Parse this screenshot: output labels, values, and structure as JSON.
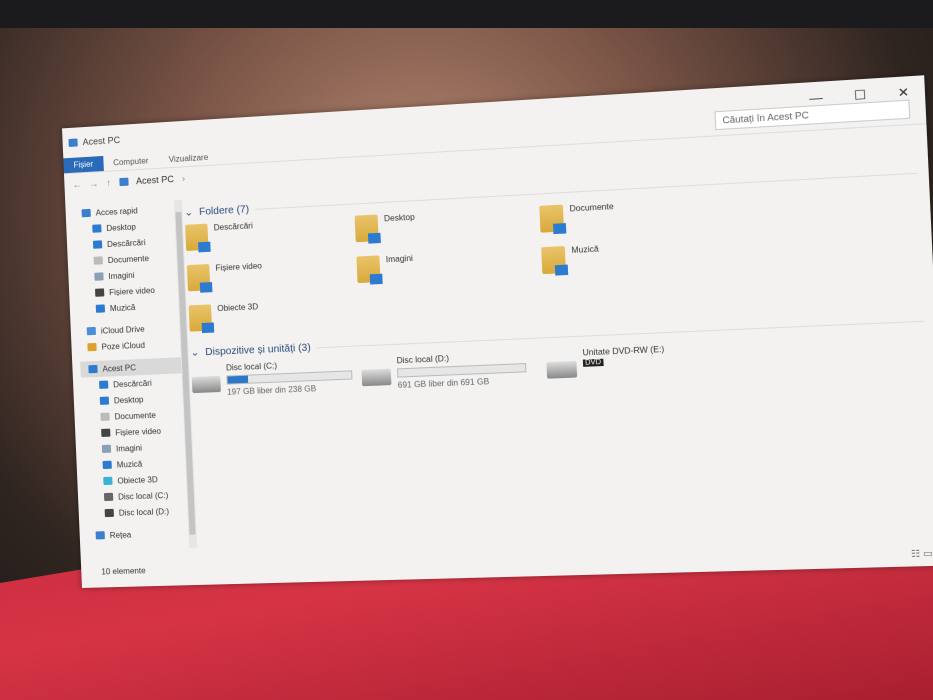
{
  "window": {
    "title": "Acest PC",
    "minimize": "—",
    "maximize": "☐",
    "close": "✕"
  },
  "ribbon": {
    "tabs": [
      "Fișier",
      "Computer",
      "Vizualizare"
    ]
  },
  "address": {
    "path": "Acest PC",
    "sep": "›",
    "search_placeholder": "Căutați în Acest PC"
  },
  "sidebar": {
    "items": [
      {
        "label": "Acces rapid",
        "indent": false,
        "color": "#3a7fcf"
      },
      {
        "label": "Desktop",
        "indent": true,
        "color": "#2c7bd1"
      },
      {
        "label": "Descărcări",
        "indent": true,
        "color": "#2c7bd1"
      },
      {
        "label": "Documente",
        "indent": true,
        "color": "#bbbbbb"
      },
      {
        "label": "Imagini",
        "indent": true,
        "color": "#8aa0b8"
      },
      {
        "label": "Fișiere video",
        "indent": true,
        "color": "#444444"
      },
      {
        "label": "Muzică",
        "indent": true,
        "color": "#2c7bd1"
      },
      {
        "label": "iCloud Drive",
        "indent": false,
        "color": "#4a8fd8"
      },
      {
        "label": "Poze iCloud",
        "indent": false,
        "color": "#e0a030"
      },
      {
        "label": "Acest PC",
        "indent": false,
        "color": "#2c7bd1",
        "selected": true
      },
      {
        "label": "Descărcări",
        "indent": true,
        "color": "#2c7bd1"
      },
      {
        "label": "Desktop",
        "indent": true,
        "color": "#2c7bd1"
      },
      {
        "label": "Documente",
        "indent": true,
        "color": "#bbbbbb"
      },
      {
        "label": "Fișiere video",
        "indent": true,
        "color": "#444444"
      },
      {
        "label": "Imagini",
        "indent": true,
        "color": "#8aa0b8"
      },
      {
        "label": "Muzică",
        "indent": true,
        "color": "#2c7bd1"
      },
      {
        "label": "Obiecte 3D",
        "indent": true,
        "color": "#3bb0d8"
      },
      {
        "label": "Disc local (C:)",
        "indent": true,
        "color": "#666666"
      },
      {
        "label": "Disc local (D:)",
        "indent": true,
        "color": "#444444"
      },
      {
        "label": "Rețea",
        "indent": false,
        "color": "#3a7fcf"
      }
    ]
  },
  "status": "10 elemente",
  "folders": {
    "header": "Foldere (7)",
    "items": [
      "Descărcări",
      "Desktop",
      "Documente",
      "Fișiere video",
      "Imagini",
      "Muzică",
      "Obiecte 3D"
    ]
  },
  "drives": {
    "header": "Dispozitive și unități (3)",
    "items": [
      {
        "name": "Disc local (C:)",
        "free": "197 GB liber din 238 GB",
        "used_pct": 17
      },
      {
        "name": "Disc local (D:)",
        "free": "691 GB liber din 691 GB",
        "used_pct": 0
      },
      {
        "name": "Unitate DVD-RW (E:)",
        "badge": "DVD"
      }
    ]
  }
}
